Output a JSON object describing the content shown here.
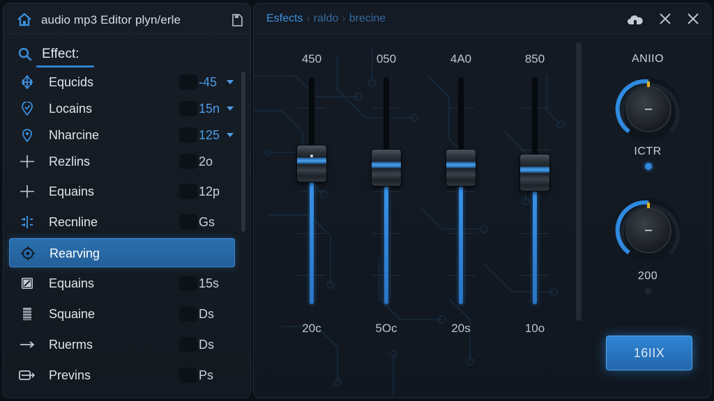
{
  "app": {
    "title": "audio mp3 Editor plyn/erle"
  },
  "icons": {
    "home": "home-icon",
    "save": "save-icon",
    "search": "search-icon",
    "cloud": "cloud-icon",
    "close": "close-icon"
  },
  "colors": {
    "accent": "#2f82d0",
    "selected_row": "#2a6fae",
    "value_blue": "#4b9ce6",
    "background": "#0c1118"
  },
  "search": {
    "label": "Effect:"
  },
  "effects": [
    {
      "label": "Equcids",
      "value": "-45",
      "dropdown": true,
      "icon": "arrows-icon"
    },
    {
      "label": "Locains",
      "value": "15n",
      "dropdown": true,
      "icon": "location-pin-icon"
    },
    {
      "label": "Nharcine",
      "value": "125",
      "dropdown": true,
      "icon": "target-pin-icon"
    },
    {
      "label": "Rezlins",
      "value": "2o",
      "dropdown": false,
      "icon": "crosshair-line-icon"
    },
    {
      "label": "Equains",
      "value": "12p",
      "dropdown": false,
      "icon": "plus-line-icon"
    },
    {
      "label": "Recnline",
      "value": "Gs",
      "dropdown": false,
      "icon": "split-bars-icon"
    },
    {
      "label": "Rearving",
      "value": "",
      "dropdown": false,
      "selected": true,
      "icon": "crosshair-circle-icon"
    },
    {
      "label": "Equains",
      "value": "15s",
      "dropdown": false,
      "icon": "edit-box-icon"
    },
    {
      "label": "Squaine",
      "value": "Ds",
      "dropdown": false,
      "icon": "stack-bars-icon"
    },
    {
      "label": "Ruerms",
      "value": "Ds",
      "dropdown": false,
      "icon": "arrow-right-icon"
    },
    {
      "label": "Previns",
      "value": "Ps",
      "dropdown": false,
      "icon": "list-arrow-icon"
    }
  ],
  "breadcrumb": [
    "Esfects",
    "raldo",
    "brecine"
  ],
  "sliders": [
    {
      "top_label": "450",
      "bottom_label": "20c",
      "level": 0.62
    },
    {
      "top_label": "050",
      "bottom_label": "5Oc",
      "level": 0.6
    },
    {
      "top_label": "4A0",
      "bottom_label": "20s",
      "level": 0.6
    },
    {
      "top_label": "850",
      "bottom_label": "10o",
      "level": 0.58
    }
  ],
  "knobs": [
    {
      "top_label": "ANIIO",
      "bottom_label": "ICTR",
      "level": 0.5,
      "led": "on"
    },
    {
      "top_label": "",
      "bottom_label": "200",
      "level": 0.5,
      "led": "off"
    }
  ],
  "mix_button": {
    "label": "16IIX"
  }
}
